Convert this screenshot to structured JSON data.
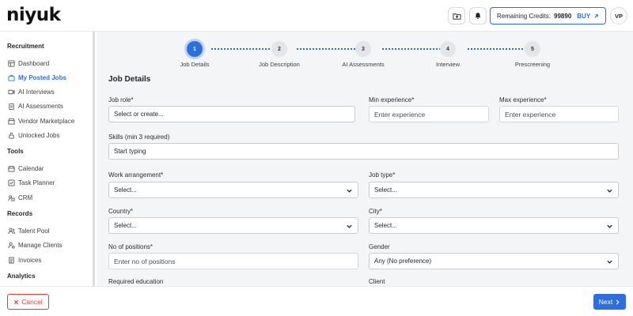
{
  "app": {
    "logo": "niyuk"
  },
  "header": {
    "credits_label": "Remaining Credits:",
    "credits_value": "99890",
    "buy_label": "BUY",
    "avatar_initials": "VP"
  },
  "sidebar": {
    "sections": [
      {
        "title": "Recruitment",
        "items": [
          {
            "label": "Dashboard",
            "icon": "dashboard-icon"
          },
          {
            "label": "My Posted Jobs",
            "icon": "briefcase-icon",
            "active": true
          },
          {
            "label": "AI Interviews",
            "icon": "video-icon"
          },
          {
            "label": "AI Assessments",
            "icon": "clipboard-icon"
          },
          {
            "label": "Vendor Marketplace",
            "icon": "store-icon"
          },
          {
            "label": "Unlocked Jobs",
            "icon": "unlock-icon"
          }
        ]
      },
      {
        "title": "Tools",
        "items": [
          {
            "label": "Calendar",
            "icon": "calendar-icon"
          },
          {
            "label": "Task Planner",
            "icon": "checklist-icon"
          },
          {
            "label": "CRM",
            "icon": "crm-icon"
          }
        ]
      },
      {
        "title": "Records",
        "items": [
          {
            "label": "Talent Pool",
            "icon": "users-icon"
          },
          {
            "label": "Manage Clients",
            "icon": "user-cog-icon"
          },
          {
            "label": "Invoices",
            "icon": "invoice-icon"
          }
        ]
      },
      {
        "title": "Analytics",
        "items": []
      }
    ]
  },
  "stepper": [
    {
      "num": "1",
      "label": "Job Details",
      "active": true
    },
    {
      "num": "2",
      "label": "Job Description"
    },
    {
      "num": "3",
      "label": "AI Assessments"
    },
    {
      "num": "4",
      "label": "Interview"
    },
    {
      "num": "5",
      "label": "Prescreening"
    }
  ],
  "form": {
    "title": "Job Details",
    "job_role": {
      "label": "Job role*",
      "value": "Select or create..."
    },
    "min_exp": {
      "label": "Min experience*",
      "placeholder": "Enter experience"
    },
    "max_exp": {
      "label": "Max experience*",
      "placeholder": "Enter experience"
    },
    "skills": {
      "label": "Skills (min 3 required)",
      "value": "Start typing"
    },
    "work_arrangement": {
      "label": "Work arrangement*",
      "value": "Select..."
    },
    "job_type": {
      "label": "Job type*",
      "value": "Select..."
    },
    "country": {
      "label": "Country*",
      "value": "Select..."
    },
    "city": {
      "label": "City*",
      "value": "Select..."
    },
    "positions": {
      "label": "No of positions*",
      "placeholder": "Enter no of positions"
    },
    "gender": {
      "label": "Gender",
      "value": "Any (No preference)"
    },
    "education": {
      "label": "Required education"
    },
    "client": {
      "label": "Client"
    }
  },
  "footer": {
    "cancel_label": "Cancel",
    "next_label": "Next"
  },
  "colors": {
    "accent": "#2f6fdb",
    "danger": "#d93f3f"
  }
}
